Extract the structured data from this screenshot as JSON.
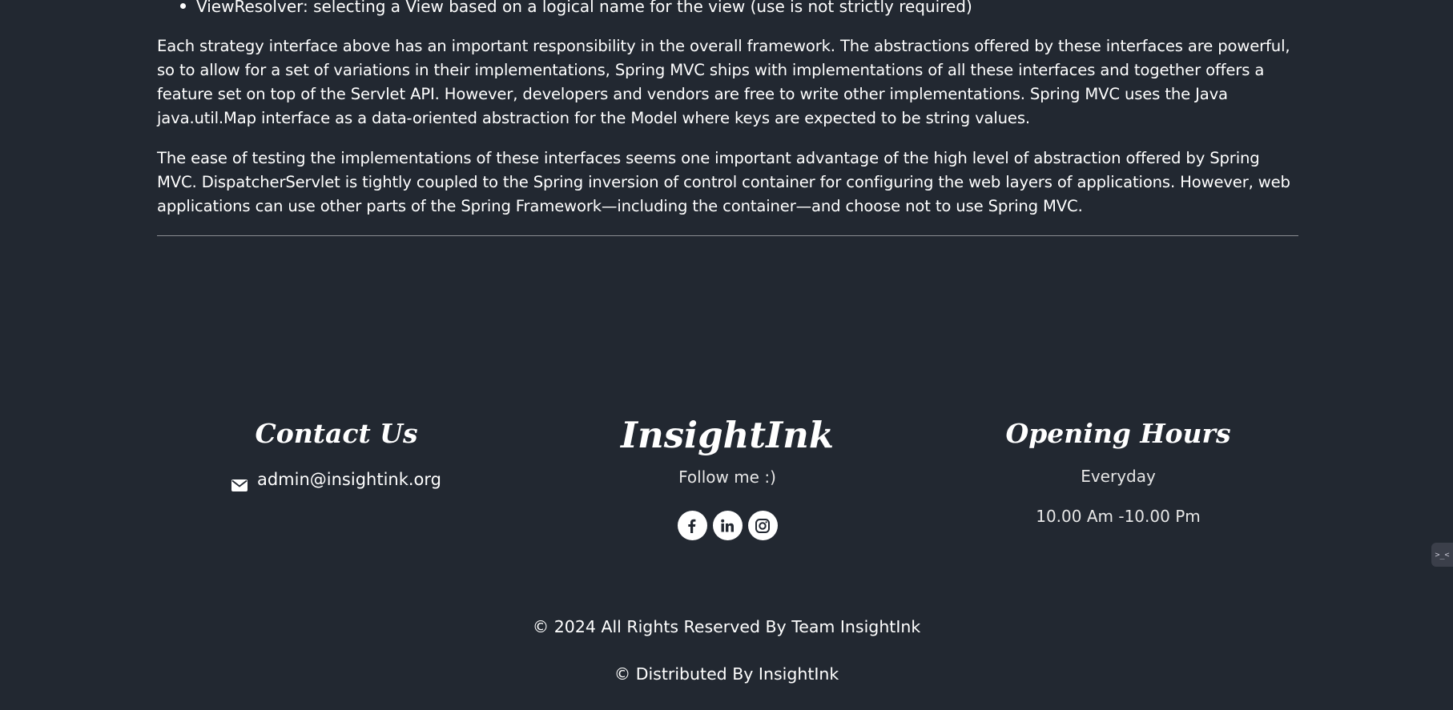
{
  "article": {
    "bullets": [
      "ViewResolver: selecting a View based on a logical name for the view (use is not strictly required)"
    ],
    "paragraph_1": "Each strategy interface above has an important responsibility in the overall framework. The abstractions offered by these interfaces are powerful, so to allow for a set of variations in their implementations, Spring MVC ships with implementations of all these interfaces and together offers a feature set on top of the Servlet API. However, developers and vendors are free to write other implementations. Spring MVC uses the Java java.util.Map interface as a data-oriented abstraction for the Model where keys are expected to be string values.",
    "paragraph_2": "The ease of testing the implementations of these interfaces seems one important advantage of the high level of abstraction offered by Spring MVC. DispatcherServlet is tightly coupled to the Spring inversion of control container for configuring the web layers of applications. However, web applications can use other parts of the Spring Framework—including the container—and choose not to use Spring MVC."
  },
  "footer": {
    "contact": {
      "title": "Contact Us",
      "email": "admin@insightink.org",
      "icon": "envelope-icon"
    },
    "brand": {
      "title": "InsightInk",
      "follow_text": "Follow me :)",
      "socials": [
        {
          "name": "facebook",
          "icon": "facebook-icon"
        },
        {
          "name": "linkedin",
          "icon": "linkedin-icon"
        },
        {
          "name": "instagram",
          "icon": "instagram-icon"
        }
      ]
    },
    "hours": {
      "title": "Opening Hours",
      "days": "Everyday",
      "time": "10.00 Am -10.00 Pm"
    },
    "copyright": "© 2024 All Rights Reserved By Team InsightInk",
    "distributed": "© Distributed By InsightInk"
  },
  "side_widget": {
    "label": ">_<"
  },
  "colors": {
    "background": "#222831",
    "text": "#ffffff",
    "muted_text": "#e6e6e6",
    "divider": "#8a8d92"
  }
}
